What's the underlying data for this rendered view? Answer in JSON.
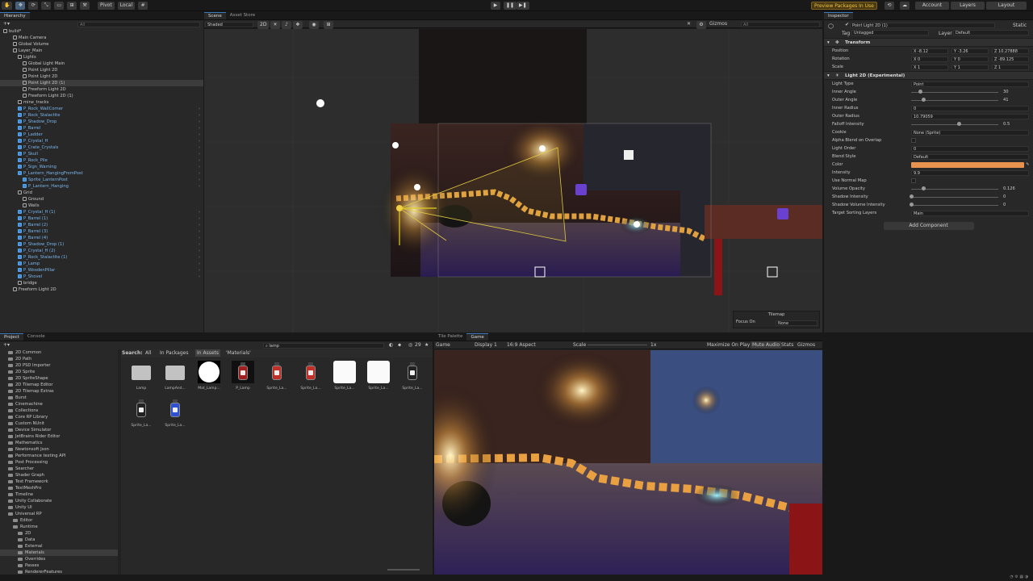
{
  "toolbar": {
    "pivot": "Pivot",
    "local": "Local",
    "preview_packages": "Preview Packages In Use",
    "account": "Account",
    "layers": "Layers",
    "layout": "Layout"
  },
  "hierarchy": {
    "tab": "Hierarchy",
    "search_placeholder": "All",
    "items": [
      {
        "label": "build*",
        "indent": 0,
        "type": "scene"
      },
      {
        "label": "Main Camera",
        "indent": 2,
        "type": "go"
      },
      {
        "label": "Global Volume",
        "indent": 2,
        "type": "go"
      },
      {
        "label": "Layer_Main",
        "indent": 2,
        "type": "go"
      },
      {
        "label": "Lights",
        "indent": 3,
        "type": "go"
      },
      {
        "label": "Global Light Main",
        "indent": 4,
        "type": "go"
      },
      {
        "label": "Point Light 2D",
        "indent": 4,
        "type": "go"
      },
      {
        "label": "Point Light 2D",
        "indent": 4,
        "type": "go"
      },
      {
        "label": "Point Light 2D (1)",
        "indent": 4,
        "type": "go",
        "selected": true
      },
      {
        "label": "Freeform Light 2D",
        "indent": 4,
        "type": "go"
      },
      {
        "label": "Freeform Light 2D (1)",
        "indent": 4,
        "type": "go"
      },
      {
        "label": "mine_tracks",
        "indent": 3,
        "type": "go"
      },
      {
        "label": "P_Rock_WallCorner",
        "indent": 3,
        "type": "prefab"
      },
      {
        "label": "P_Rock_Stalactite",
        "indent": 3,
        "type": "prefab"
      },
      {
        "label": "P_Shadow_Drop",
        "indent": 3,
        "type": "prefab"
      },
      {
        "label": "P_Barrel",
        "indent": 3,
        "type": "prefab"
      },
      {
        "label": "P_Ladder",
        "indent": 3,
        "type": "prefab"
      },
      {
        "label": "P_Crystal_H",
        "indent": 3,
        "type": "prefab"
      },
      {
        "label": "P_Crate_Crystals",
        "indent": 3,
        "type": "prefab"
      },
      {
        "label": "P_Skull",
        "indent": 3,
        "type": "prefab"
      },
      {
        "label": "P_Rock_Pile",
        "indent": 3,
        "type": "prefab"
      },
      {
        "label": "P_Sign_Warning",
        "indent": 3,
        "type": "prefab"
      },
      {
        "label": "P_Lantern_HangingFromPost",
        "indent": 3,
        "type": "prefab"
      },
      {
        "label": "Sprite_LanternPost",
        "indent": 4,
        "type": "prefab"
      },
      {
        "label": "P_Lantern_Hanging",
        "indent": 4,
        "type": "prefab"
      },
      {
        "label": "Grid",
        "indent": 3,
        "type": "go"
      },
      {
        "label": "Ground",
        "indent": 4,
        "type": "go"
      },
      {
        "label": "Walls",
        "indent": 4,
        "type": "go"
      },
      {
        "label": "P_Crystal_H (1)",
        "indent": 3,
        "type": "prefab"
      },
      {
        "label": "P_Barrel (1)",
        "indent": 3,
        "type": "prefab"
      },
      {
        "label": "P_Barrel (2)",
        "indent": 3,
        "type": "prefab"
      },
      {
        "label": "P_Barrel (3)",
        "indent": 3,
        "type": "prefab"
      },
      {
        "label": "P_Barrel (4)",
        "indent": 3,
        "type": "prefab"
      },
      {
        "label": "P_Shadow_Drop (1)",
        "indent": 3,
        "type": "prefab"
      },
      {
        "label": "P_Crystal_H (2)",
        "indent": 3,
        "type": "prefab"
      },
      {
        "label": "P_Rock_Stalactite (1)",
        "indent": 3,
        "type": "prefab"
      },
      {
        "label": "P_Lamp",
        "indent": 3,
        "type": "prefab"
      },
      {
        "label": "P_WoodenPillar",
        "indent": 3,
        "type": "prefab"
      },
      {
        "label": "P_Shovel",
        "indent": 3,
        "type": "prefab"
      },
      {
        "label": "bridge",
        "indent": 3,
        "type": "go"
      },
      {
        "label": "Freeform Light 2D",
        "indent": 2,
        "type": "go"
      }
    ]
  },
  "scene": {
    "tab_scene": "Scene",
    "tab_asset_store": "Asset Store",
    "shading": "Shaded",
    "mode_2d": "2D",
    "gizmos": "Gizmos",
    "search_placeholder": "All",
    "overlay_title": "Tilemap",
    "overlay_focus_label": "Focus On",
    "overlay_focus_value": "None"
  },
  "inspector": {
    "tab": "Inspector",
    "object_name": "Point Light 2D (1)",
    "static": "Static",
    "tag_label": "Tag",
    "tag_value": "Untagged",
    "layer_label": "Layer",
    "layer_value": "Default",
    "transform": {
      "title": "Transform",
      "position_label": "Position",
      "rotation_label": "Rotation",
      "scale_label": "Scale",
      "position": {
        "x": "-8.12",
        "y": "-3.26",
        "z": "10.27888"
      },
      "rotation": {
        "x": "0",
        "y": "0",
        "z": "-89.125"
      },
      "scale": {
        "x": "1",
        "y": "1",
        "z": "1"
      }
    },
    "light": {
      "title": "Light 2D (Experimental)",
      "light_type_label": "Light Type",
      "light_type": "Point",
      "inner_angle_label": "Inner Angle",
      "inner_angle": "30",
      "outer_angle_label": "Outer Angle",
      "outer_angle": "41",
      "inner_radius_label": "Inner Radius",
      "inner_radius": "0",
      "outer_radius_label": "Outer Radius",
      "outer_radius": "10.79059",
      "falloff_label": "Falloff Intensity",
      "falloff": "0.5",
      "cookie_label": "Cookie",
      "cookie": "None (Sprite)",
      "alpha_blend_label": "Alpha Blend on Overlap",
      "light_order_label": "Light Order",
      "light_order": "0",
      "blend_style_label": "Blend Style",
      "blend_style": "Default",
      "color_label": "Color",
      "color": "#e8924f",
      "intensity_label": "Intensity",
      "intensity": "9.9",
      "normal_map_label": "Use Normal Map",
      "volume_opacity_label": "Volume Opacity",
      "volume_opacity": "0.126",
      "shadow_intensity_label": "Shadow Intensity",
      "shadow_intensity": "0",
      "shadow_volume_label": "Shadow Volume Intensity",
      "shadow_volume": "0",
      "sorting_layers_label": "Target Sorting Layers",
      "sorting_layers": "Main"
    },
    "add_component": "Add Component"
  },
  "project": {
    "tab_project": "Project",
    "tab_console": "Console",
    "search_value": "lamp",
    "result_count": "29",
    "search_label": "Search:",
    "filter_all": "All",
    "filter_packages": "In Packages",
    "filter_assets": "In Assets",
    "filter_materials": "'Materials'",
    "tree": [
      {
        "label": "2D Common",
        "indent": 1
      },
      {
        "label": "2D Path",
        "indent": 1
      },
      {
        "label": "2D PSD Importer",
        "indent": 1
      },
      {
        "label": "2D Sprite",
        "indent": 1
      },
      {
        "label": "2D SpriteShape",
        "indent": 1
      },
      {
        "label": "2D Tilemap Editor",
        "indent": 1
      },
      {
        "label": "2D Tilemap Extras",
        "indent": 1
      },
      {
        "label": "Burst",
        "indent": 1
      },
      {
        "label": "Cinemachine",
        "indent": 1
      },
      {
        "label": "Collections",
        "indent": 1
      },
      {
        "label": "Core RP Library",
        "indent": 1
      },
      {
        "label": "Custom NUnit",
        "indent": 1
      },
      {
        "label": "Device Simulator",
        "indent": 1
      },
      {
        "label": "JetBrains Rider Editor",
        "indent": 1
      },
      {
        "label": "Mathematics",
        "indent": 1
      },
      {
        "label": "Newtonsoft Json",
        "indent": 1
      },
      {
        "label": "Performance testing API",
        "indent": 1
      },
      {
        "label": "Post Processing",
        "indent": 1
      },
      {
        "label": "Searcher",
        "indent": 1
      },
      {
        "label": "Shader Graph",
        "indent": 1
      },
      {
        "label": "Test Framework",
        "indent": 1
      },
      {
        "label": "TextMeshPro",
        "indent": 1
      },
      {
        "label": "Timeline",
        "indent": 1
      },
      {
        "label": "Unity Collaborate",
        "indent": 1
      },
      {
        "label": "Unity UI",
        "indent": 1
      },
      {
        "label": "Universal RP",
        "indent": 1
      },
      {
        "label": "Editor",
        "indent": 2
      },
      {
        "label": "Runtime",
        "indent": 2
      },
      {
        "label": "2D",
        "indent": 3
      },
      {
        "label": "Data",
        "indent": 3
      },
      {
        "label": "External",
        "indent": 3
      },
      {
        "label": "Materials",
        "indent": 3,
        "selected": true
      },
      {
        "label": "Overrides",
        "indent": 3
      },
      {
        "label": "Passes",
        "indent": 3
      },
      {
        "label": "RendererFeatures",
        "indent": 3
      }
    ],
    "assets": [
      {
        "label": "Lamp",
        "kind": "folder"
      },
      {
        "label": "LampAnd...",
        "kind": "folder"
      },
      {
        "label": "Mat_Lamp...",
        "kind": "white-circle"
      },
      {
        "label": "P_Lamp",
        "kind": "lamp-red-dark"
      },
      {
        "label": "Sprite_La...",
        "kind": "lamp-red"
      },
      {
        "label": "Sprite_La...",
        "kind": "lamp-red"
      },
      {
        "label": "Sprite_La...",
        "kind": "white-square"
      },
      {
        "label": "Sprite_La...",
        "kind": "white-square"
      },
      {
        "label": "Sprite_La...",
        "kind": "lamp-black"
      },
      {
        "label": "Sprite_La...",
        "kind": "lamp-black"
      },
      {
        "label": "Sprite_La...",
        "kind": "lamp-blue"
      }
    ]
  },
  "game": {
    "tab_tile_palette": "Tile Palette",
    "tab_game": "Game",
    "display_mode": "Game",
    "display": "Display 1",
    "aspect": "16:9 Aspect",
    "scale_label": "Scale",
    "scale_value": "1x",
    "maximize": "Maximize On Play",
    "mute": "Mute Audio",
    "stats": "Stats",
    "gizmos": "Gizmos"
  }
}
